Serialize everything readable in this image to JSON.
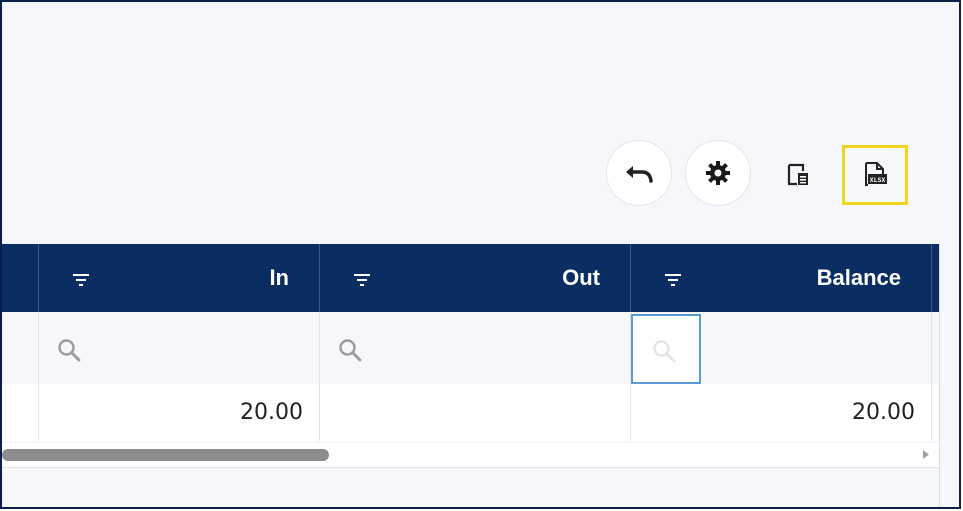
{
  "toolbar": {
    "undo_icon": "undo-icon",
    "settings_icon": "gear-icon",
    "layout_icon": "page-layout-icon",
    "xlsx_icon": "xlsx-file-icon",
    "highlight_color": "#f3d21b"
  },
  "grid": {
    "header_color": "#0a2e62",
    "columns": [
      {
        "label": ""
      },
      {
        "label": "In"
      },
      {
        "label": "Out"
      },
      {
        "label": "Balance"
      }
    ],
    "rows": [
      {
        "in": "20.00",
        "out": "",
        "balance": "20.00"
      }
    ]
  }
}
